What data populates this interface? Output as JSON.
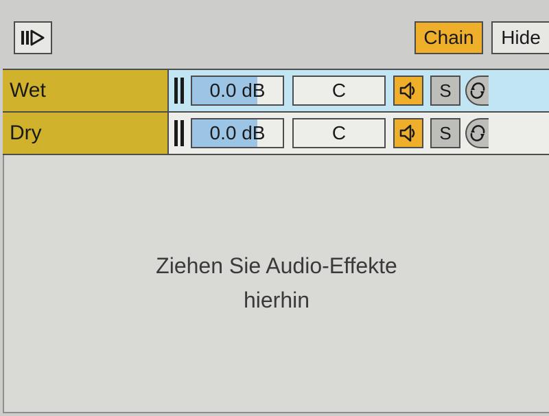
{
  "toolbar": {
    "chain_label": "Chain",
    "hide_label": "Hide"
  },
  "chains": [
    {
      "name": "Wet",
      "gain": "0.0 dB",
      "gain_fill_pct": 72,
      "pan": "C",
      "solo_label": "S",
      "selected": true
    },
    {
      "name": "Dry",
      "gain": "0.0 dB",
      "gain_fill_pct": 72,
      "pan": "C",
      "solo_label": "S",
      "selected": false
    }
  ],
  "drop_hint_line1": "Ziehen Sie Audio-Effekte",
  "drop_hint_line2": "hierhin"
}
